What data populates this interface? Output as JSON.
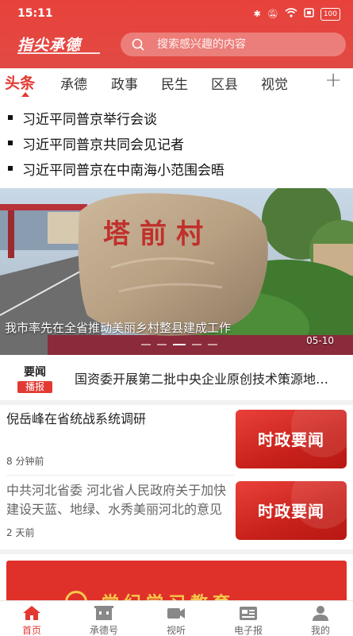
{
  "status_bar": {
    "time": "15:11",
    "battery": "100"
  },
  "header": {
    "brand": "指尖承德",
    "search_placeholder": "搜索感兴趣的内容"
  },
  "tabs": [
    {
      "label": "头条",
      "active": true
    },
    {
      "label": "承德",
      "active": false
    },
    {
      "label": "政事",
      "active": false
    },
    {
      "label": "民生",
      "active": false
    },
    {
      "label": "区县",
      "active": false
    },
    {
      "label": "视觉",
      "active": false
    }
  ],
  "headlines": [
    "习近平同普京举行会谈",
    "习近平同普京共同会见记者",
    "习近平同普京在中南海小范围会晤"
  ],
  "banner": {
    "stone_text": "塔前村",
    "caption": "我市率先在全省推动美丽乡村整县建成工作",
    "date": "05-10",
    "slide_count": 5,
    "active_slide": 3
  },
  "ticker": {
    "badge_top": "要闻",
    "badge_bottom": "播报",
    "text": "国资委开展第二批中央企业原创技术策源地建设"
  },
  "news": [
    {
      "title": "倪岳峰在省统战系统调研",
      "meta": "8 分钟前",
      "thumb": "时政要闻",
      "muted": false
    },
    {
      "title": "中共河北省委  河北省人民政府关于加快建设天蓝、地绿、水秀美丽河北的意见",
      "meta": "2 天前",
      "thumb": "时政要闻",
      "muted": true
    }
  ],
  "promo": {
    "text": "党纪学习教育"
  },
  "bottom_nav": [
    {
      "label": "首页",
      "icon": "home-icon",
      "active": true
    },
    {
      "label": "承德号",
      "icon": "building-icon",
      "active": false
    },
    {
      "label": "视听",
      "icon": "video-camera-icon",
      "active": false
    },
    {
      "label": "电子报",
      "icon": "newspaper-icon",
      "active": false
    },
    {
      "label": "我的",
      "icon": "user-icon",
      "active": false
    }
  ],
  "colors": {
    "brand_red": "#e23a32",
    "gold": "#f5c94b"
  }
}
